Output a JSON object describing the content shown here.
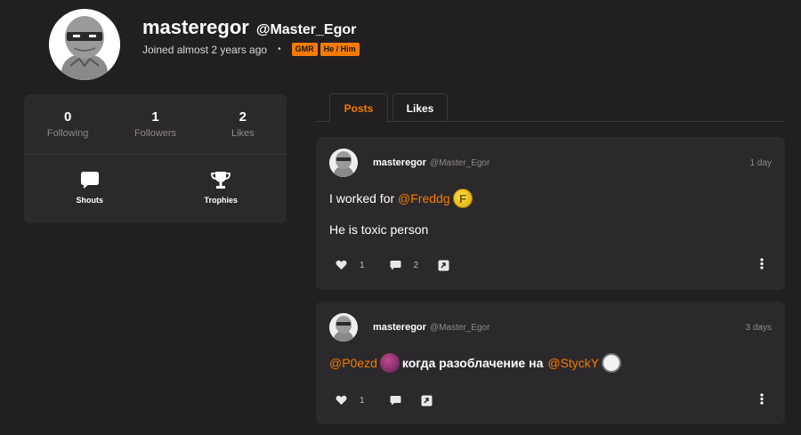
{
  "profile": {
    "display_name": "masteregor",
    "handle": "@Master_Egor",
    "joined": "Joined almost 2 years ago",
    "badges": [
      "GMR",
      "He / Him"
    ],
    "accent_color": "#f47b00"
  },
  "stats": [
    {
      "value": "0",
      "label": "Following"
    },
    {
      "value": "1",
      "label": "Followers"
    },
    {
      "value": "2",
      "label": "Likes"
    }
  ],
  "links": [
    {
      "label": "Shouts",
      "icon": "speech-bubble-icon"
    },
    {
      "label": "Trophies",
      "icon": "trophy-icon"
    }
  ],
  "tabs": [
    {
      "label": "Posts",
      "active": true
    },
    {
      "label": "Likes",
      "active": false
    }
  ],
  "posts": [
    {
      "author": "masteregor",
      "handle": "@Master_Egor",
      "time": "1 day",
      "line1_prefix": "I worked for ",
      "line1_mention": "@Freddg",
      "line2": "He is toxic person",
      "likes": "1",
      "comments": "2"
    },
    {
      "author": "masteregor",
      "handle": "@Master_Egor",
      "time": "3 days",
      "mention1": "@P0ezd",
      "middle": "когда разоблачение на",
      "mention2": "@StyckY",
      "likes": "1"
    }
  ]
}
